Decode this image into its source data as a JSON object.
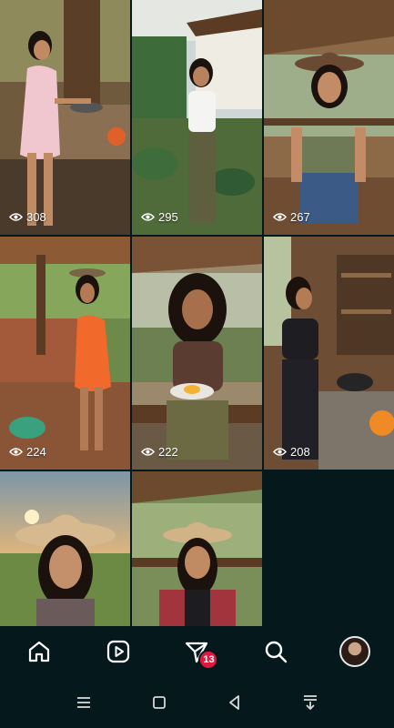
{
  "posts": [
    {
      "views": "308",
      "scene": "outdoor-kitchen"
    },
    {
      "views": "295",
      "scene": "farmhouse-garden"
    },
    {
      "views": "267",
      "scene": "porch-cowboy-hat"
    },
    {
      "views": "224",
      "scene": "clay-stove-kitchen"
    },
    {
      "views": "222",
      "scene": "bench-egg-plate"
    },
    {
      "views": "208",
      "scene": "wood-stove-cooking"
    },
    {
      "views": "",
      "scene": "sunset-field-hat"
    },
    {
      "views": "",
      "scene": "veranda-hat-plaid"
    }
  ],
  "nav": {
    "items": [
      "home-icon",
      "reels-icon",
      "direct-icon",
      "search-icon",
      "profile-avatar"
    ],
    "direct_badge": "13"
  },
  "system_nav": [
    "menu-icon",
    "home-square-icon",
    "back-icon",
    "download-icon"
  ],
  "colors": {
    "background": "#05191c",
    "badge": "#e3173e"
  }
}
